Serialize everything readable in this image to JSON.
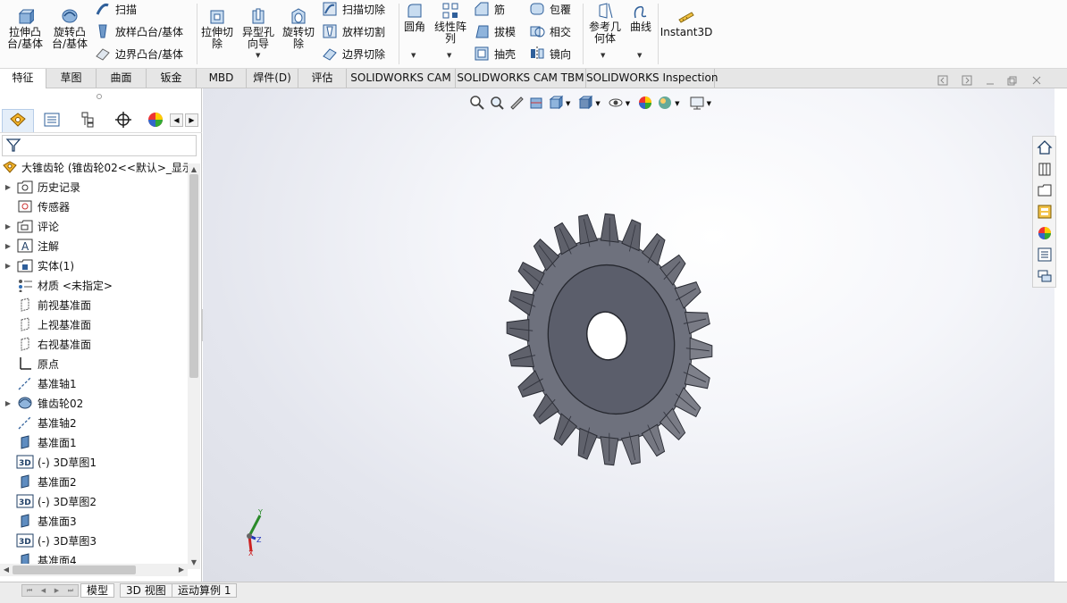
{
  "ribbon": {
    "extrude_boss": "拉伸凸\n台/基体",
    "revolve_boss": "旋转凸\n台/基体",
    "sweep": "扫描",
    "loft_boss": "放样凸台/基体",
    "boundary_boss": "边界凸台/基体",
    "extrude_cut": "拉伸切\n除",
    "hole_wizard": "异型孔\n向导",
    "revolve_cut": "旋转切\n除",
    "swept_cut": "扫描切除",
    "lofted_cut": "放样切割",
    "boundary_cut": "边界切除",
    "fillet": "圆角",
    "linear_pattern": "线性阵\n列",
    "rib": "筋",
    "draft": "拔模",
    "shell": "抽壳",
    "wrap": "包覆",
    "intersect": "相交",
    "mirror": "镜向",
    "reference_geometry": "参考几\n何体",
    "curves": "曲线",
    "instant3d": "Instant3D"
  },
  "tabs": [
    "特征",
    "草图",
    "曲面",
    "钣金",
    "MBD",
    "焊件(D)",
    "评估",
    "SOLIDWORKS CAM",
    "SOLIDWORKS CAM TBM",
    "SOLIDWORKS Inspection"
  ],
  "tree": {
    "root": "大锥齿轮  (锥齿轮02<<默认>_显示",
    "items": [
      {
        "label": "历史记录",
        "icon": "history-folder-icon",
        "expand": true
      },
      {
        "label": "传感器",
        "icon": "sensor-icon",
        "expand": false
      },
      {
        "label": "评论",
        "icon": "comment-icon",
        "expand": true
      },
      {
        "label": "注解",
        "icon": "annotation-icon",
        "expand": true
      },
      {
        "label": "实体(1)",
        "icon": "solid-bodies-icon",
        "expand": true
      },
      {
        "label": "材质 <未指定>",
        "icon": "material-icon",
        "expand": false
      },
      {
        "label": "前视基准面",
        "icon": "plane-icon",
        "expand": false
      },
      {
        "label": "上视基准面",
        "icon": "plane-icon",
        "expand": false
      },
      {
        "label": "右视基准面",
        "icon": "plane-icon",
        "expand": false
      },
      {
        "label": "原点",
        "icon": "origin-icon",
        "expand": false
      },
      {
        "label": "基准轴1",
        "icon": "axis-icon",
        "expand": false
      },
      {
        "label": "锥齿轮02",
        "icon": "toolbox-part-icon",
        "expand": true
      },
      {
        "label": "基准轴2",
        "icon": "axis-icon",
        "expand": false
      },
      {
        "label": "基准面1",
        "icon": "plane-solid-icon",
        "expand": false
      },
      {
        "label": "(-) 3D草图1",
        "icon": "3d-sketch-icon",
        "expand": false
      },
      {
        "label": "基准面2",
        "icon": "plane-solid-icon",
        "expand": false
      },
      {
        "label": "(-) 3D草图2",
        "icon": "3d-sketch-icon",
        "expand": false
      },
      {
        "label": "基准面3",
        "icon": "plane-solid-icon",
        "expand": false
      },
      {
        "label": "(-) 3D草图3",
        "icon": "3d-sketch-icon",
        "expand": false
      },
      {
        "label": "基准面4",
        "icon": "plane-solid-icon",
        "expand": false
      }
    ]
  },
  "triad": {
    "x": "X",
    "y": "Y",
    "z": "Z"
  },
  "bottom_tabs": [
    "模型",
    "3D 视图",
    "运动算例 1"
  ],
  "colors": {
    "gear": "#5b5e6b",
    "accent": "#2f6db5"
  }
}
